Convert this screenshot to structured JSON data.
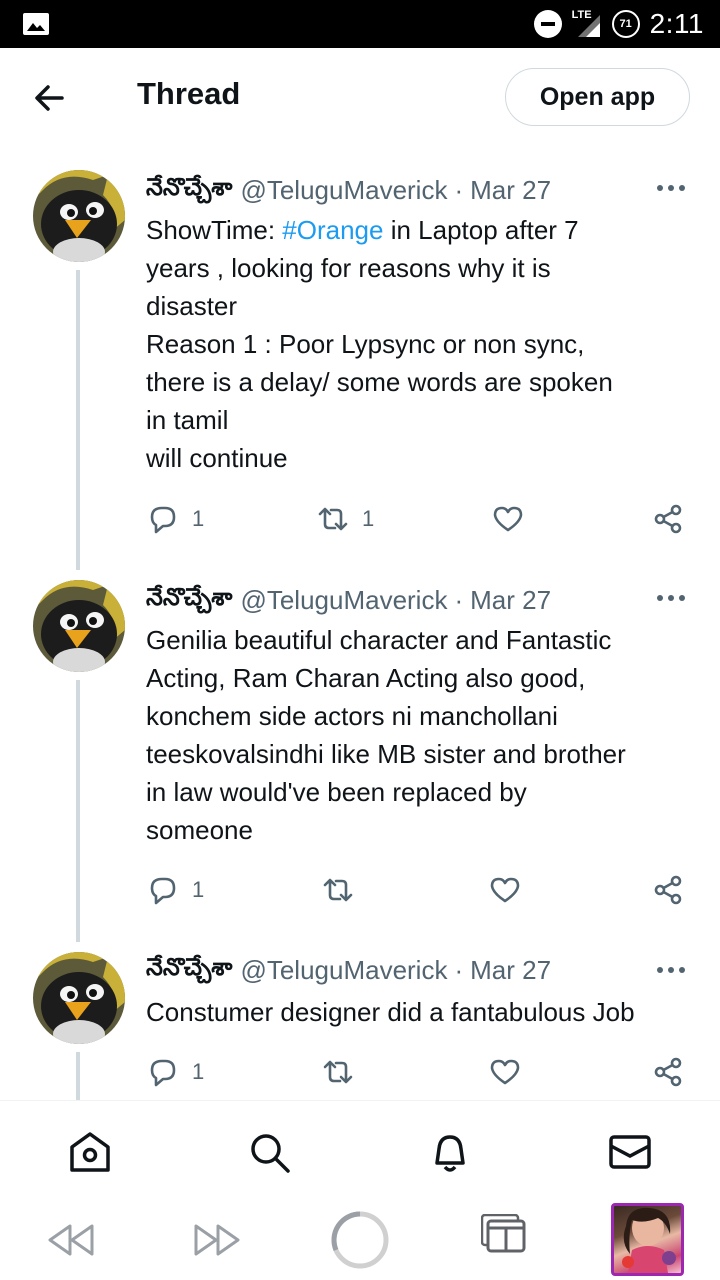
{
  "status_bar": {
    "network": "LTE",
    "battery": "71",
    "time": "2:11"
  },
  "header": {
    "title": "Thread",
    "open_app_label": "Open app"
  },
  "tweets": [
    {
      "name": "నేనొచ్చేశా",
      "handle": "@TeluguMaverick",
      "separator": "·",
      "date": "Mar 27",
      "body_lines": [
        [
          "ShowTime: ",
          "#Orange",
          " in Laptop after 7"
        ],
        "years , looking for reasons why it is",
        "disaster",
        "Reason 1 : Poor Lypsync or non sync,",
        "there is a delay/ some words are spoken",
        "in tamil",
        "will continue"
      ],
      "replies": "1",
      "retweets": "1",
      "likes": ""
    },
    {
      "name": "నేనొచ్చేశా",
      "handle": "@TeluguMaverick",
      "separator": "·",
      "date": "Mar 27",
      "body_lines": [
        "Genilia beautiful character and Fantastic",
        "Acting, Ram Charan Acting also good,",
        "konchem side actors ni manchollani",
        "teeskovalsindhi like MB sister and brother",
        "in law would've been replaced by",
        "someone"
      ],
      "replies": "1",
      "retweets": "",
      "likes": ""
    },
    {
      "name": "నేనొచ్చేశా",
      "handle": "@TeluguMaverick",
      "separator": "·",
      "date": "Mar 27",
      "body_lines": [
        "Constumer designer did a fantabulous Job"
      ],
      "replies": "1",
      "retweets": "",
      "likes": ""
    }
  ],
  "bottom_nav": [
    "home-icon",
    "search-icon",
    "bell-icon",
    "mail-icon"
  ],
  "browser_bar": [
    "rewind-icon",
    "fast-forward-icon",
    "loading-icon",
    "tabs-icon",
    "profile-thumbnail"
  ],
  "colors": {
    "link": "#1d9bf0",
    "text": "#0f1419",
    "secondary": "#536471",
    "thread_line": "#cfd9de",
    "profile_border": "#9c27b0"
  }
}
